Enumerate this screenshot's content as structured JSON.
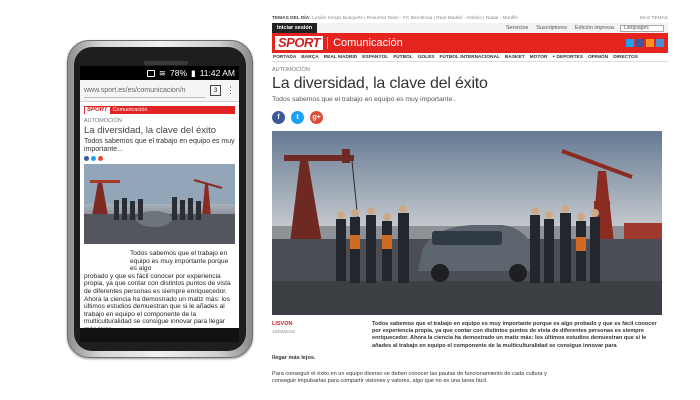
{
  "phone": {
    "status_time": "11:42 AM",
    "battery": "78%",
    "url": "www.sport.es/es/comunicacion/n",
    "tab_count": "3",
    "article": {
      "brand": "SPORT",
      "section": "Comunicación",
      "category": "AUTOMOCIÓN",
      "title": "La diversidad, la clave del éxito",
      "subtitle": "Todos sabemos que el trabajo en equipo es muy importante...",
      "body_indented": "Todos sabemos que el trabajo en equipo es muy importante porque es algo",
      "body_full": "probado y que es fácil conocer por experiencia propia, ya que contar con distintos puntos de vista de diferentes personas es siempre enriquecedor. Ahora la ciencia ha demostrado un matiz más: los últimos estudios demuestran que si le añades al trabajo en equipo el componente de la multiculturalidad se consigue innovar para llegar más lejos."
    }
  },
  "desktop": {
    "topics_label": "TEMAS DEL DÍA:",
    "topics": "Lesión Sergio Busquets | Resurrier Dilan - FC Barcelona | Real Madrid - Atlético | Nadal - Monfils",
    "more_topics": "MÁS TEMAS",
    "login": "Iniciar sesión",
    "top_links": [
      "Servicios",
      "Suscriptores",
      "Edición impresa"
    ],
    "language": "Languages",
    "brand": "SPORT",
    "section": "Comunicación",
    "menu": [
      "PORTADA",
      "BARÇA",
      "REAL MADRID",
      "ESPANYOL",
      "FÚTBOL",
      "GOLES",
      "FÚTBOL INTERNACIONAL",
      "BASKET",
      "MOTOR",
      "+ DEPORTES",
      "OPINIÓN",
      "DIRECTOS"
    ],
    "category": "AUTOMOCIÓN",
    "title": "La diversidad, la clave del éxito",
    "subtitle": "Todos sabemos que el trabajo en equipo es muy importante..",
    "author": "LISVON",
    "date": "10/03/2016",
    "lead": "Todos sabemos que el trabajo en equipo es muy importante porque es algo probado y que es fácil conocer por experiencia propia, ya que contar con distintos puntos de vista de diferentes personas es siempre enriquecedor. Ahora la ciencia ha demostrado un matiz más: los últimos estudios demuestran que si le añades al trabajo en equipo el componente de la multiculturalidad se consigue innovar para",
    "lead_cont": "llegar más lejos.",
    "body": "Para conseguir el éxito en un equipo diverso se deben conocer las pautas de funcionamiento de cada cultura y conseguir impulsarlas para compartir visiones y valores, algo que no es una tarea fácil.",
    "social": [
      "f",
      "t",
      "g+"
    ]
  },
  "colors": {
    "brand_red": "#e52420",
    "facebook": "#3b5998",
    "twitter": "#1da1f2",
    "gplus": "#dd4b39"
  }
}
